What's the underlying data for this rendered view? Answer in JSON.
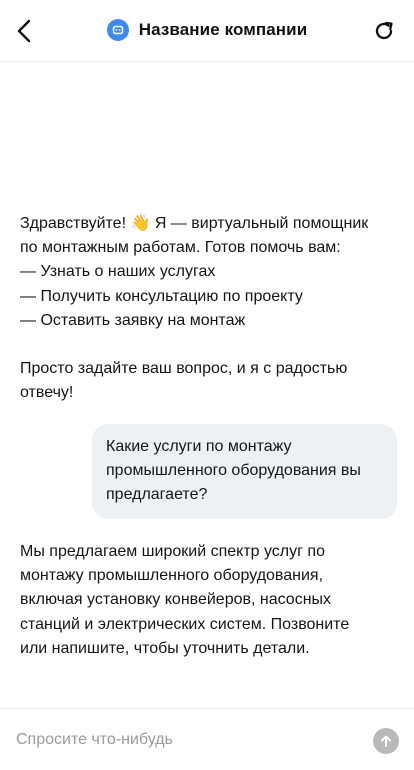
{
  "header": {
    "title": "Название компании",
    "back_icon": "chevron-left-icon",
    "avatar_icon": "bot-icon",
    "reload_icon": "refresh-icon",
    "accent_color": "#3d8bf2"
  },
  "messages": {
    "bot_greeting": "Здравствуйте! 👋 Я — виртуальный помощник\nпо монтажным работам. Готов помочь вам:\n— Узнать о наших услугах\n— Получить консультацию по проекту\n— Оставить заявку на монтаж\n\nПросто задайте ваш вопрос, и я с радостью\nотвечу!",
    "user_question": "Какие услуги по монтажу\nпромышленного оборудования вы\nпредлагаете?",
    "bot_answer": "Мы предлагаем широкий спектр услуг по\nмонтажу промышленного оборудования,\nвключая установку конвейеров, насосных\nстанций и электрических систем. Позвоните\nили напишите, чтобы уточнить детали."
  },
  "composer": {
    "placeholder": "Спросите что-нибудь",
    "value": "",
    "send_icon": "arrow-up-icon"
  }
}
